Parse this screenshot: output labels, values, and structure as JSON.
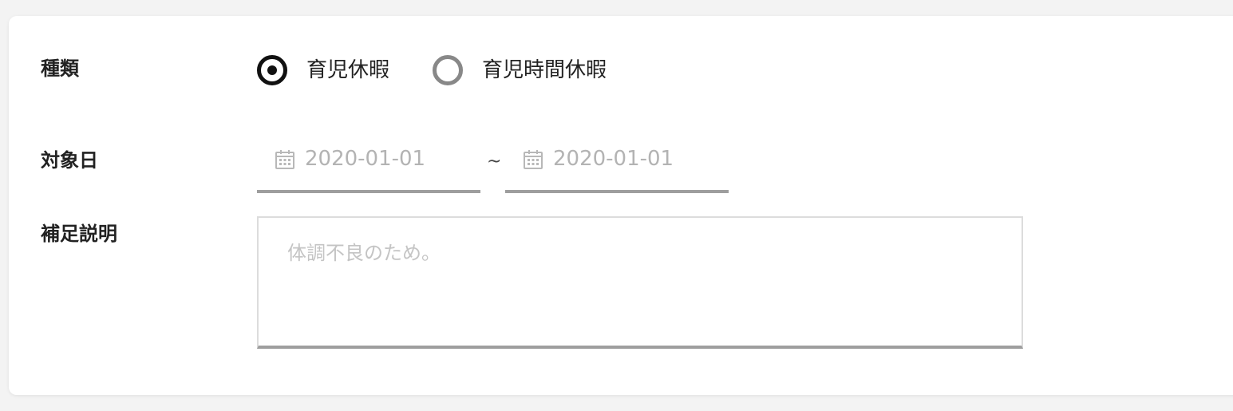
{
  "form": {
    "type_label": "種類",
    "date_label": "対象日",
    "note_label": "補足説明",
    "type_options": [
      {
        "label": "育児休暇",
        "selected": true
      },
      {
        "label": "育児時間休暇",
        "selected": false
      }
    ],
    "date_from": "2020-01-01",
    "date_to": "2020-01-01",
    "date_separator": "~",
    "note_placeholder": "体調不良のため。",
    "icons": {
      "selected_radio": "radio-selected-icon",
      "unselected_radio": "radio-unselected-icon",
      "date": "calendar-icon"
    },
    "colors": {
      "selected_radio": "#111111",
      "unselected_radio": "#888888",
      "placeholder": "#b3b3b3",
      "underline": "#9e9e9e"
    }
  }
}
